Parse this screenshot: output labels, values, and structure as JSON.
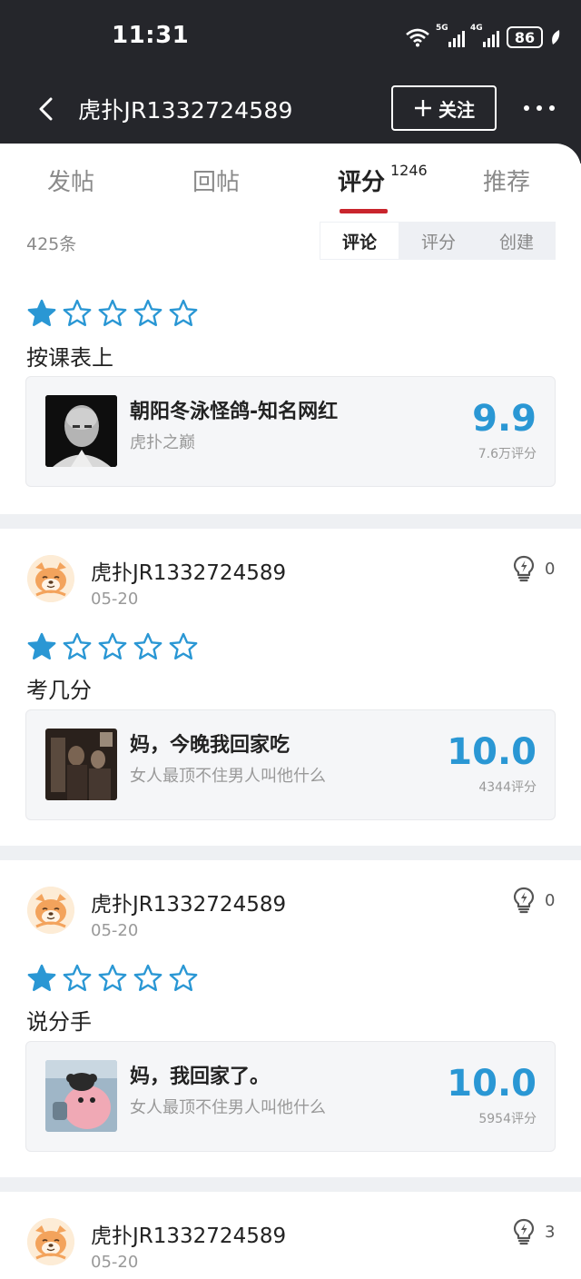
{
  "status_bar": {
    "time": "11:31",
    "net1": "5G",
    "net2": "4G",
    "battery": "86"
  },
  "header": {
    "title": "虎扑JR1332724589",
    "follow_label": "关注"
  },
  "tabs": [
    {
      "label": "发帖"
    },
    {
      "label": "回帖"
    },
    {
      "label": "评分",
      "count": "1246"
    },
    {
      "label": "推荐"
    }
  ],
  "filter": {
    "count": "425条",
    "options": [
      "评论",
      "评分",
      "创建"
    ],
    "selected": "评论"
  },
  "colors": {
    "accent": "#2a97d4",
    "active_tab": "#c9252d",
    "header_bg": "#25262b"
  },
  "reviews": [
    {
      "rating": 1,
      "text": "按课表上",
      "item": {
        "title": "朝阳冬泳怪鸽-知名网红",
        "subtitle": "虎扑之巅",
        "score": "9.9",
        "votes": "7.6万评分"
      }
    },
    {
      "user": "虎扑JR1332724589",
      "date": "05-20",
      "likes": "0",
      "rating": 1,
      "text": "考几分",
      "item": {
        "title": "妈，今晚我回家吃",
        "subtitle": "女人最顶不住男人叫他什么",
        "score": "10.0",
        "votes": "4344评分"
      }
    },
    {
      "user": "虎扑JR1332724589",
      "date": "05-20",
      "likes": "0",
      "rating": 1,
      "text": "说分手",
      "item": {
        "title": "妈，我回家了。",
        "subtitle": "女人最顶不住男人叫他什么",
        "score": "10.0",
        "votes": "5954评分"
      }
    },
    {
      "user": "虎扑JR1332724589",
      "date": "05-20",
      "likes": "3"
    }
  ]
}
